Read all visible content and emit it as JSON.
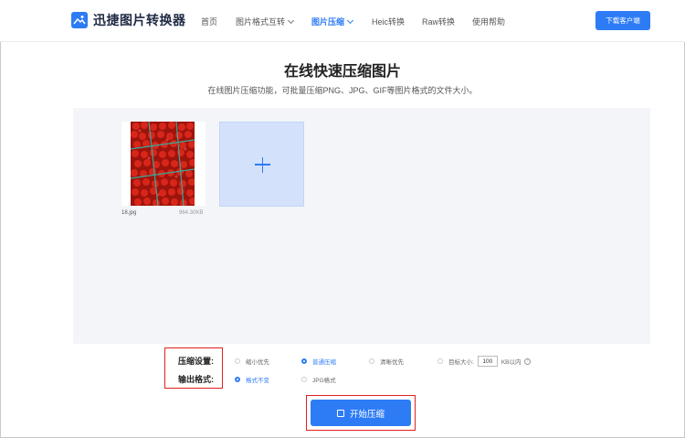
{
  "app": {
    "name": "迅捷图片转换器"
  },
  "nav": {
    "items": [
      {
        "label": "首页",
        "active": false,
        "dropdown": false
      },
      {
        "label": "图片格式互转",
        "active": false,
        "dropdown": true
      },
      {
        "label": "图片压缩",
        "active": true,
        "dropdown": true
      },
      {
        "label": "Heic转换",
        "active": false,
        "dropdown": false
      },
      {
        "label": "Raw转换",
        "active": false,
        "dropdown": false
      },
      {
        "label": "使用帮助",
        "active": false,
        "dropdown": false
      }
    ],
    "download_label": "下载客户端"
  },
  "page": {
    "title": "在线快速压缩图片",
    "subtitle": "在线图片压缩功能，可批量压缩PNG、JPG、GIF等图片格式的文件大小。"
  },
  "files": [
    {
      "name": "18.jpg",
      "size": "964.30KB"
    }
  ],
  "settings": {
    "compress_label": "压缩设置:",
    "compress_options": [
      {
        "label": "缩小优先",
        "selected": false
      },
      {
        "label": "普通压缩",
        "selected": true
      },
      {
        "label": "清晰优先",
        "selected": false
      },
      {
        "label": "目标大小:",
        "selected": false
      }
    ],
    "target_value": "100",
    "target_unit": "KB以内",
    "format_label": "输出格式:",
    "format_options": [
      {
        "label": "格式不变",
        "selected": true
      },
      {
        "label": "JPG格式",
        "selected": false
      }
    ]
  },
  "start_button_label": "开始压缩",
  "colors": {
    "accent": "#2d7cf6",
    "highlight_border": "#e02020"
  }
}
